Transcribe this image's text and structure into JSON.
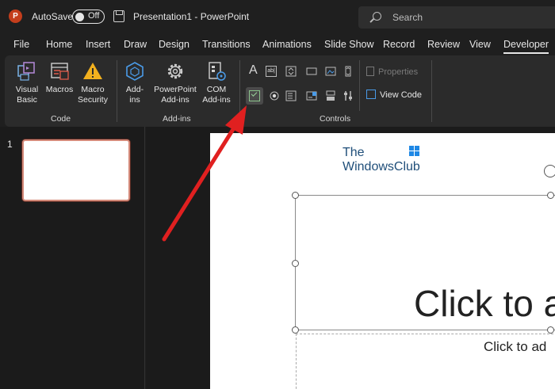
{
  "titlebar": {
    "app_logo_letter": "P",
    "autosave_label": "AutoSave",
    "autosave_state": "Off",
    "document_title": "Presentation1  -  PowerPoint",
    "search_placeholder": "Search"
  },
  "menu": {
    "tabs": [
      "File",
      "Home",
      "Insert",
      "Draw",
      "Design",
      "Transitions",
      "Animations",
      "Slide Show",
      "Record",
      "Review",
      "View",
      "Developer"
    ],
    "active": "Developer"
  },
  "ribbon": {
    "code_group": {
      "label": "Code",
      "buttons": [
        {
          "label_line1": "Visual",
          "label_line2": "Basic",
          "icon": "visual-basic-icon"
        },
        {
          "label_line1": "Macros",
          "label_line2": "",
          "icon": "macros-icon"
        },
        {
          "label_line1": "Macro",
          "label_line2": "Security",
          "icon": "warning-icon"
        }
      ]
    },
    "addins_group": {
      "label": "Add-ins",
      "buttons": [
        {
          "label_line1": "Add-",
          "label_line2": "ins",
          "icon": "hexagon-addins-icon"
        },
        {
          "label_line1": "PowerPoint",
          "label_line2": "Add-ins",
          "icon": "gear-icon"
        },
        {
          "label_line1": "COM",
          "label_line2": "Add-ins",
          "icon": "com-addins-icon"
        }
      ]
    },
    "controls_group": {
      "label": "Controls",
      "properties_label": "Properties",
      "view_code_label": "View Code",
      "label_glyph": "A",
      "textbox_glyph": "ab|"
    }
  },
  "slides_pane": {
    "slide_number": "1"
  },
  "slide": {
    "logo_line1": "The",
    "logo_line2": "WindowsClub",
    "title_placeholder": "Click to a",
    "subtitle_placeholder": "Click to ad"
  },
  "colors": {
    "accent_red_arrow": "#e02020",
    "powerpoint_brand": "#c43e1c",
    "checkbox_green": "#9ad29a"
  }
}
